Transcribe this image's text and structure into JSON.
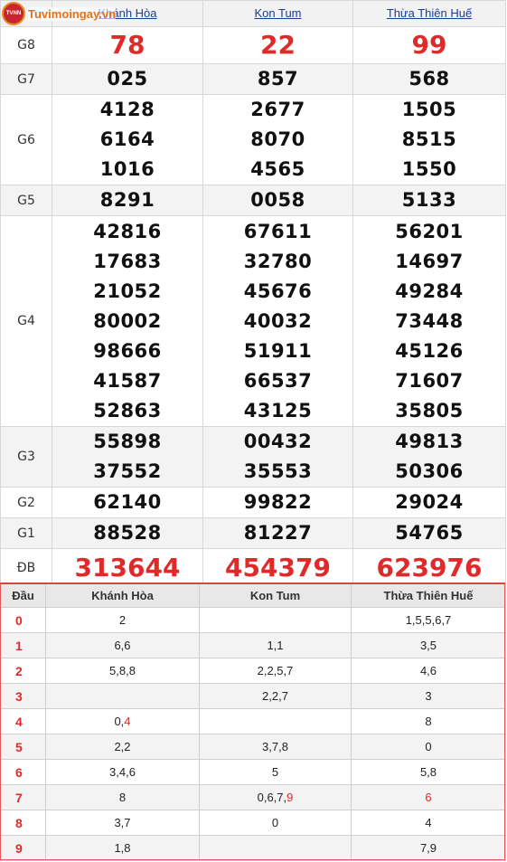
{
  "logo": {
    "text": "Tuvimoingay.vn",
    "badge": "TVNN"
  },
  "provinces": [
    "Khánh Hòa",
    "Kon Tum",
    "Thừa Thiên Huế"
  ],
  "prizes": [
    {
      "label": "G8",
      "values": [
        [
          "78"
        ],
        [
          "22"
        ],
        [
          "99"
        ]
      ]
    },
    {
      "label": "G7",
      "values": [
        [
          "025"
        ],
        [
          "857"
        ],
        [
          "568"
        ]
      ]
    },
    {
      "label": "G6",
      "values": [
        [
          "4128",
          "6164",
          "1016"
        ],
        [
          "2677",
          "8070",
          "4565"
        ],
        [
          "1505",
          "8515",
          "1550"
        ]
      ]
    },
    {
      "label": "G5",
      "values": [
        [
          "8291"
        ],
        [
          "0058"
        ],
        [
          "5133"
        ]
      ]
    },
    {
      "label": "G4",
      "values": [
        [
          "42816",
          "17683",
          "21052",
          "80002",
          "98666",
          "41587",
          "52863"
        ],
        [
          "67611",
          "32780",
          "45676",
          "40032",
          "51911",
          "66537",
          "43125"
        ],
        [
          "56201",
          "14697",
          "49284",
          "73448",
          "45126",
          "71607",
          "35805"
        ]
      ]
    },
    {
      "label": "G3",
      "values": [
        [
          "55898",
          "37552"
        ],
        [
          "00432",
          "35553"
        ],
        [
          "49813",
          "50306"
        ]
      ]
    },
    {
      "label": "G2",
      "values": [
        [
          "62140"
        ],
        [
          "99822"
        ],
        [
          "29024"
        ]
      ]
    },
    {
      "label": "G1",
      "values": [
        [
          "88528"
        ],
        [
          "81227"
        ],
        [
          "54765"
        ]
      ]
    },
    {
      "label": "ĐB",
      "values": [
        [
          "313644"
        ],
        [
          "454379"
        ],
        [
          "623976"
        ]
      ]
    }
  ],
  "loto": {
    "header": [
      "Đầu",
      "Khánh Hòa",
      "Kon Tum",
      "Thừa Thiên Huế"
    ],
    "rows": [
      {
        "head": "0",
        "cols": [
          [
            {
              "t": "2"
            }
          ],
          [],
          [
            {
              "t": "1,5,5,6,7"
            }
          ]
        ]
      },
      {
        "head": "1",
        "cols": [
          [
            {
              "t": "6,6"
            }
          ],
          [
            {
              "t": "1,1"
            }
          ],
          [
            {
              "t": "3,5"
            }
          ]
        ]
      },
      {
        "head": "2",
        "cols": [
          [
            {
              "t": "5,8,8"
            }
          ],
          [
            {
              "t": "2,2,5,7"
            }
          ],
          [
            {
              "t": "4,6"
            }
          ]
        ]
      },
      {
        "head": "3",
        "cols": [
          [],
          [
            {
              "t": "2,2,7"
            }
          ],
          [
            {
              "t": "3"
            }
          ]
        ]
      },
      {
        "head": "4",
        "cols": [
          [
            {
              "t": "0,"
            },
            {
              "t": "4",
              "red": true
            }
          ],
          [],
          [
            {
              "t": "8"
            }
          ]
        ]
      },
      {
        "head": "5",
        "cols": [
          [
            {
              "t": "2,2"
            }
          ],
          [
            {
              "t": "3,7,8"
            }
          ],
          [
            {
              "t": "0"
            }
          ]
        ]
      },
      {
        "head": "6",
        "cols": [
          [
            {
              "t": "3,4,6"
            }
          ],
          [
            {
              "t": "5"
            }
          ],
          [
            {
              "t": "5,8"
            }
          ]
        ]
      },
      {
        "head": "7",
        "cols": [
          [
            {
              "t": "8"
            }
          ],
          [
            {
              "t": "0,6,7,"
            },
            {
              "t": "9",
              "red": true
            }
          ],
          [
            {
              "t": "6",
              "red": true
            }
          ]
        ]
      },
      {
        "head": "8",
        "cols": [
          [
            {
              "t": "3,7"
            }
          ],
          [
            {
              "t": "0"
            }
          ],
          [
            {
              "t": "4"
            }
          ]
        ]
      },
      {
        "head": "9",
        "cols": [
          [
            {
              "t": "1,8"
            }
          ],
          [],
          [
            {
              "t": "7,9"
            }
          ]
        ]
      }
    ]
  },
  "colors": {
    "accent_red": "#e02a2a",
    "link_blue": "#1a3d9c",
    "logo_orange": "#e8701a"
  }
}
